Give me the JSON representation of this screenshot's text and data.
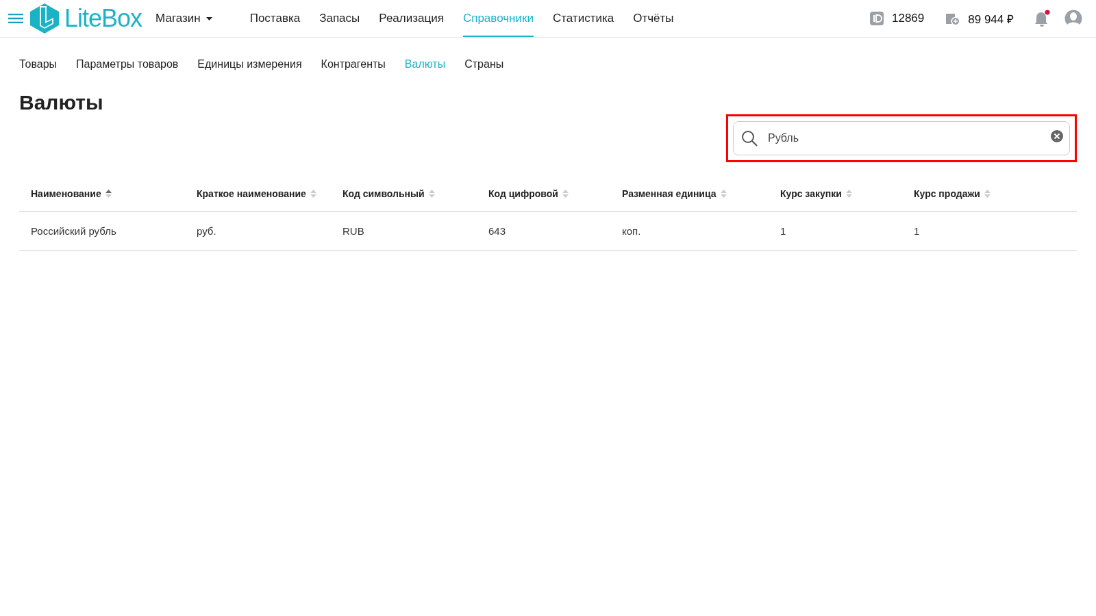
{
  "header": {
    "logo": "LiteBox",
    "store": "Магазин",
    "nav": [
      {
        "label": "Поставка",
        "selected": false
      },
      {
        "label": "Запасы",
        "selected": false
      },
      {
        "label": "Реализация",
        "selected": false
      },
      {
        "label": "Справочники",
        "selected": true
      },
      {
        "label": "Статистика",
        "selected": false
      },
      {
        "label": "Отчёты",
        "selected": false
      }
    ],
    "account_id": "12869",
    "balance": "89 944 ₽",
    "has_notifications": true
  },
  "subnav": [
    {
      "label": "Товары",
      "selected": false
    },
    {
      "label": "Параметры товаров",
      "selected": false
    },
    {
      "label": "Единицы измерения",
      "selected": false
    },
    {
      "label": "Контрагенты",
      "selected": false
    },
    {
      "label": "Валюты",
      "selected": true
    },
    {
      "label": "Страны",
      "selected": false
    }
  ],
  "page_title": "Валюты",
  "search": {
    "value": "Рубль",
    "highlighted": true
  },
  "table": {
    "columns": [
      {
        "label": "Наименование",
        "sorted": true
      },
      {
        "label": "Краткое наименование",
        "sorted": false
      },
      {
        "label": "Код символьный",
        "sorted": false
      },
      {
        "label": "Код цифровой",
        "sorted": false
      },
      {
        "label": "Разменная единица",
        "sorted": false
      },
      {
        "label": "Курс закупки",
        "sorted": false
      },
      {
        "label": "Курс продажи",
        "sorted": false
      }
    ],
    "rows": [
      [
        "Российский рубль",
        "руб.",
        "RUB",
        "643",
        "коп.",
        "1",
        "1"
      ]
    ]
  }
}
